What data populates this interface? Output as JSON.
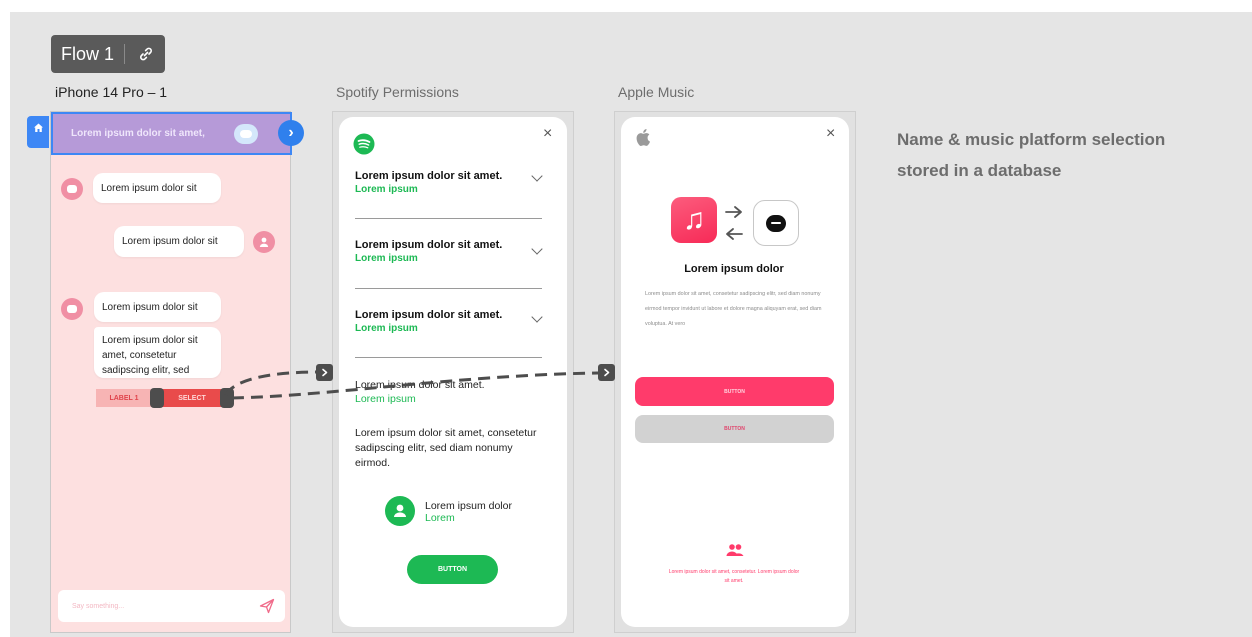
{
  "flow": {
    "label": "Flow 1"
  },
  "frames": {
    "iphone": {
      "title": "iPhone 14 Pro – 1"
    },
    "spotify": {
      "title": "Spotify Permissions"
    },
    "apple": {
      "title": "Apple Music"
    }
  },
  "chat": {
    "header": "Lorem ipsum dolor sit amet,",
    "messages": [
      "Lorem ipsum dolor sit",
      "Lorem ipsum dolor sit",
      "Lorem ipsum dolor sit",
      "Lorem ipsum dolor sit amet, consetetur sadipscing elitr, sed"
    ],
    "label_chip": "LABEL 1",
    "select_chip": "SELECT",
    "composer_placeholder": "Say something..."
  },
  "spotify": {
    "permissions": [
      {
        "title": "Lorem ipsum dolor sit amet.",
        "sub": "Lorem ipsum"
      },
      {
        "title": "Lorem ipsum dolor sit amet.",
        "sub": "Lorem ipsum"
      },
      {
        "title": "Lorem ipsum dolor sit amet.",
        "sub": "Lorem ipsum"
      },
      {
        "title": "Lorem ipsum dolor sit amet.",
        "sub": "Lorem ipsum"
      }
    ],
    "description": "Lorem ipsum dolor sit amet, consetetur sadipscing elitr, sed diam nonumy eirmod.",
    "user_name": "Lorem ipsum dolor",
    "user_sub": "Lorem",
    "button": "BUTTON",
    "close": "×"
  },
  "apple": {
    "title": "Lorem ipsum dolor",
    "paragraph": "Lorem ipsum dolor sit amet, consetetur sadipscing elitr, sed diam nonumy eirmod tempor invidunt ut labore et dolore magna aliquyam erat, sed diam voluptua. At vero",
    "primary_button": "BUTTON",
    "secondary_button": "BUTTON",
    "footer": "Lorem ipsum dolor sit amet, consetetur. Lorem ipsum dolor sit amet.",
    "close": "×"
  },
  "note": {
    "line1": "Name & music platform selection",
    "line2": "stored in a database"
  },
  "colors": {
    "spotify_green": "#1db954",
    "apple_pink": "#ff3b6b",
    "chat_header": "#b69ad8",
    "chat_bg": "#fde0e0",
    "selection_blue": "#3d87f5"
  },
  "icons": [
    "link-icon",
    "home-icon",
    "chat-bubble-icon",
    "chevron-right-icon",
    "robot-avatar-icon",
    "user-avatar-icon",
    "send-icon",
    "spotify-logo-icon",
    "chevron-down-icon",
    "close-icon",
    "user-icon",
    "apple-logo-icon",
    "music-note-icon",
    "arrow-right-icon",
    "arrow-left-icon",
    "message-icon",
    "people-icon",
    "connector-arrow-icon"
  ]
}
